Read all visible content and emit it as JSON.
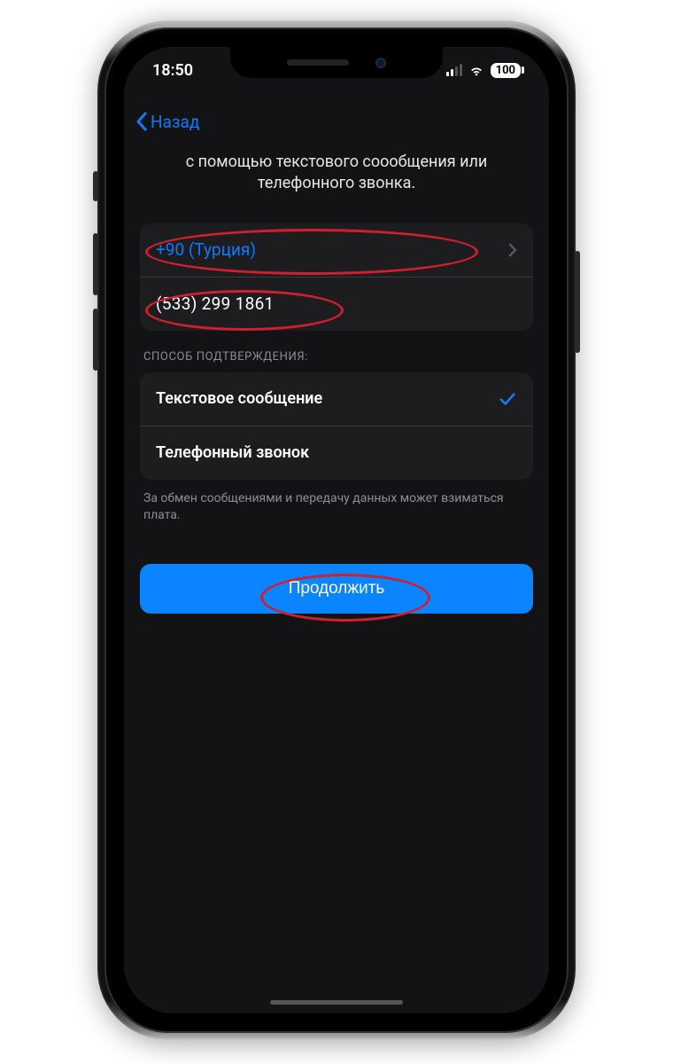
{
  "status": {
    "time": "18:50",
    "battery": "100"
  },
  "nav": {
    "back_label": "Назад"
  },
  "page": {
    "subtitle_line1": "с помощью текстового соообщения или",
    "subtitle_line2": "телефонного звонка."
  },
  "phone": {
    "country_label": "+90 (Турция)",
    "number": "(533) 299 1861"
  },
  "verify": {
    "section_label": "СПОСОБ ПОДТВЕРЖДЕНИЯ:",
    "options": [
      {
        "label": "Текстовое сообщение",
        "selected": true
      },
      {
        "label": "Телефонный звонок",
        "selected": false
      }
    ],
    "footnote": "За обмен сообщениями и передачу данных может взиматься плата."
  },
  "cta": {
    "label": "Продолжить"
  }
}
